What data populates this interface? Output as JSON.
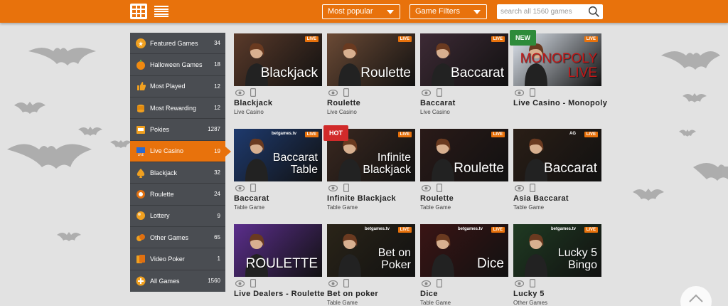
{
  "search": {
    "placeholder": "search all 1560 games"
  },
  "filters": {
    "sort_label": "Most popular",
    "filters_label": "Game Filters"
  },
  "sidebar": {
    "items": [
      {
        "label": "Featured Games",
        "count": "34",
        "icon": "star-icon"
      },
      {
        "label": "Halloween Games",
        "count": "18",
        "icon": "pumpkin-icon"
      },
      {
        "label": "Most Played",
        "count": "12",
        "icon": "thumbs-up-icon"
      },
      {
        "label": "Most Rewarding",
        "count": "12",
        "icon": "coins-icon"
      },
      {
        "label": "Pokies",
        "count": "1287",
        "icon": "slot-machine-icon"
      },
      {
        "label": "Live Casino",
        "count": "19",
        "icon": "live-tv-icon",
        "active": true
      },
      {
        "label": "Blackjack",
        "count": "32",
        "icon": "spade-icon"
      },
      {
        "label": "Roulette",
        "count": "24",
        "icon": "roulette-icon"
      },
      {
        "label": "Lottery",
        "count": "9",
        "icon": "lottery-ball-icon"
      },
      {
        "label": "Other Games",
        "count": "65",
        "icon": "chips-icon"
      },
      {
        "label": "Video Poker",
        "count": "1",
        "icon": "cards-icon"
      },
      {
        "label": "All Games",
        "count": "1560",
        "icon": "plus-circle-icon"
      }
    ]
  },
  "games": [
    {
      "name": "Blackjack",
      "category": "Live Casino",
      "thumb_title": "Blackjack",
      "badge": "LIVE",
      "bg": "#5a3a2a"
    },
    {
      "name": "Roulette",
      "category": "Live Casino",
      "thumb_title": "Roulette",
      "badge": "LIVE",
      "bg": "#6b4a35"
    },
    {
      "name": "Baccarat",
      "category": "Live Casino",
      "thumb_title": "Baccarat",
      "badge": "LIVE",
      "bg": "#3d2a35"
    },
    {
      "name": "Live Casino - Monopoly",
      "category": "",
      "thumb_title": "MONOPOLY LIVE",
      "badge": "LIVE",
      "flag": "NEW",
      "bg": "#dfe6ef"
    },
    {
      "name": "Baccarat",
      "category": "Table Game",
      "thumb_title": "Baccarat\nTable",
      "badge": "LIVE",
      "brand": "betgames.tv",
      "bg": "#1e3a6e"
    },
    {
      "name": "Infinite Blackjack",
      "category": "Table Game",
      "thumb_title": "Infinite\nBlackjack",
      "badge": "LIVE",
      "flag": "HOT",
      "bg": "#3a2820"
    },
    {
      "name": "Roulette",
      "category": "Table Game",
      "thumb_title": "Roulette",
      "badge": "LIVE",
      "bg": "#2a1a18"
    },
    {
      "name": "Asia Baccarat",
      "category": "Table Game",
      "thumb_title": "Baccarat",
      "badge": "LIVE",
      "brand": "AG",
      "bg": "#2a1e16"
    },
    {
      "name": "Live Dealers - Roulette",
      "category": "",
      "thumb_title": "ROULETTE",
      "badge": "",
      "bg": "#5b2e8c"
    },
    {
      "name": "Bet on poker",
      "category": "Table Game",
      "thumb_title": "Bet on\nPoker",
      "badge": "LIVE",
      "brand": "betgames.tv",
      "bg": "#2a2418"
    },
    {
      "name": "Dice",
      "category": "Table Game",
      "thumb_title": "Dice",
      "badge": "LIVE",
      "brand": "betgames.tv",
      "bg": "#3a1414"
    },
    {
      "name": "Lucky 5",
      "category": "Other Games",
      "thumb_title": "Lucky 5\nBingo",
      "badge": "LIVE",
      "brand": "betgames.tv",
      "bg": "#1f3a22"
    }
  ],
  "colors": {
    "accent": "#e8720c",
    "sidebar": "#4a4d52",
    "background": "#e2e2e2"
  }
}
